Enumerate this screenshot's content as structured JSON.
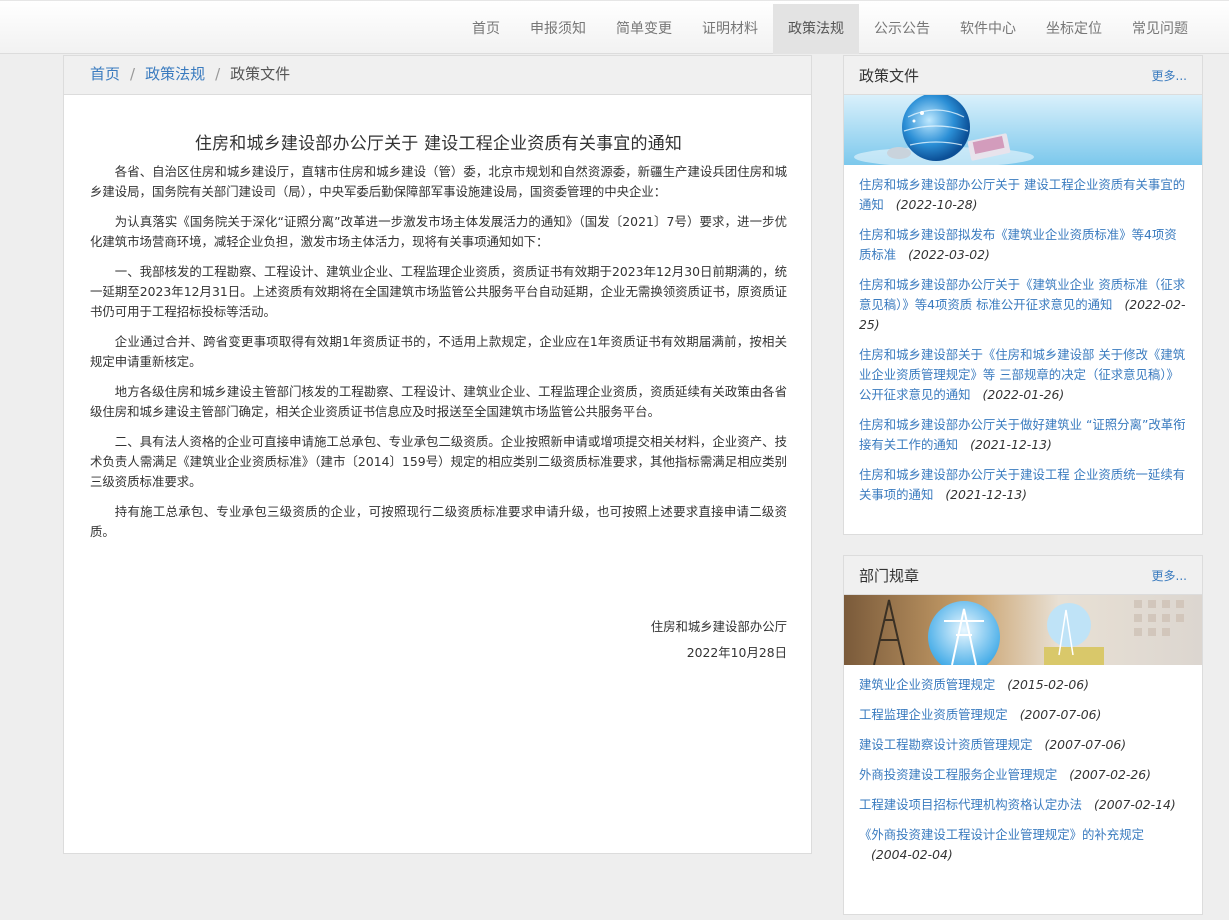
{
  "nav": {
    "items": [
      "首页",
      "申报须知",
      "简单变更",
      "证明材料",
      "政策法规",
      "公示公告",
      "软件中心",
      "坐标定位",
      "常见问题"
    ],
    "active_index": 4
  },
  "breadcrumb": {
    "home": "首页",
    "sep1": "/",
    "section": "政策法规",
    "sep2": "/",
    "current": "政策文件"
  },
  "article": {
    "title": "住房和城乡建设部办公厅关于 建设工程企业资质有关事宜的通知",
    "paragraphs": [
      "各省、自治区住房和城乡建设厅，直辖市住房和城乡建设（管）委，北京市规划和自然资源委，新疆生产建设兵团住房和城乡建设局，国务院有关部门建设司（局），中央军委后勤保障部军事设施建设局，国资委管理的中央企业：",
      "为认真落实《国务院关于深化“证照分离”改革进一步激发市场主体发展活力的通知》（国发〔2021〕7号）要求，进一步优化建筑市场营商环境，减轻企业负担，激发市场主体活力，现将有关事项通知如下：",
      "一、我部核发的工程勘察、工程设计、建筑业企业、工程监理企业资质，资质证书有效期于2023年12月30日前期满的，统一延期至2023年12月31日。上述资质有效期将在全国建筑市场监管公共服务平台自动延期，企业无需换领资质证书，原资质证书仍可用于工程招标投标等活动。",
      "企业通过合并、跨省变更事项取得有效期1年资质证书的，不适用上款规定，企业应在1年资质证书有效期届满前，按相关规定申请重新核定。",
      "地方各级住房和城乡建设主管部门核发的工程勘察、工程设计、建筑业企业、工程监理企业资质，资质延续有关政策由各省级住房和城乡建设主管部门确定，相关企业资质证书信息应及时报送至全国建筑市场监管公共服务平台。",
      "二、具有法人资格的企业可直接申请施工总承包、专业承包二级资质。企业按照新申请或增项提交相关材料，企业资产、技术负责人需满足《建筑业企业资质标准》（建市〔2014〕159号）规定的相应类别二级资质标准要求，其他指标需满足相应类别三级资质标准要求。",
      "持有施工总承包、专业承包三级资质的企业，可按照现行二级资质标准要求申请升级，也可按照上述要求直接申请二级资质。"
    ],
    "signature_org": "住房和城乡建设部办公厅",
    "signature_date": "2022年10月28日"
  },
  "policy_docs": {
    "title": "政策文件",
    "more": "更多...",
    "items": [
      {
        "title": "住房和城乡建设部办公厅关于 建设工程企业资质有关事宜的通知",
        "date": "(2022-10-28)"
      },
      {
        "title": "住房和城乡建设部拟发布《建筑业企业资质标准》等4项资质标准",
        "date": "(2022-03-02)"
      },
      {
        "title": "住房和城乡建设部办公厅关于《建筑业企业 资质标准（征求意见稿）》等4项资质 标准公开征求意见的通知",
        "date": "(2022-02-25)"
      },
      {
        "title": "住房和城乡建设部关于《住房和城乡建设部 关于修改《建筑业企业资质管理规定》等 三部规章的决定（征求意见稿）》 公开征求意见的通知",
        "date": "(2022-01-26)"
      },
      {
        "title": "住房和城乡建设部办公厅关于做好建筑业 “证照分离”改革衔接有关工作的通知",
        "date": "(2021-12-13)"
      },
      {
        "title": "住房和城乡建设部办公厅关于建设工程 企业资质统一延续有关事项的通知",
        "date": "(2021-12-13)"
      }
    ]
  },
  "regulations": {
    "title": "部门规章",
    "more": "更多...",
    "items": [
      {
        "title": "建筑业企业资质管理规定",
        "date": "(2015-02-06)"
      },
      {
        "title": "工程监理企业资质管理规定",
        "date": "(2007-07-06)"
      },
      {
        "title": "建设工程勘察设计资质管理规定",
        "date": "(2007-07-06)"
      },
      {
        "title": "外商投资建设工程服务企业管理规定",
        "date": "(2007-02-26)"
      },
      {
        "title": "工程建设项目招标代理机构资格认定办法",
        "date": "(2007-02-14)"
      },
      {
        "title": "《外商投资建设工程设计企业管理规定》的补充规定",
        "date": "(2004-02-04)"
      }
    ]
  },
  "colors": {
    "link": "#3a7bbf",
    "nav_active_bg": "#e3e3e3",
    "panel_header": "#f0f0f0"
  }
}
